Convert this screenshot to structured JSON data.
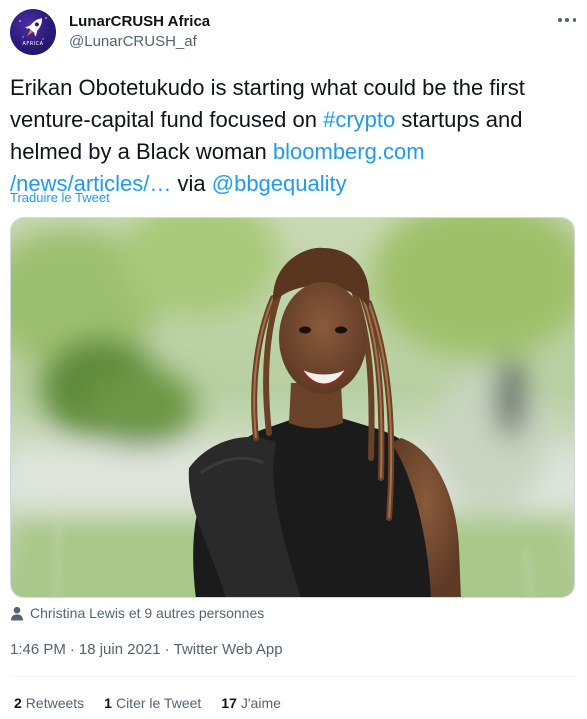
{
  "header": {
    "display_name": "LunarCRUSH Africa",
    "handle": "@LunarCRUSH_af",
    "avatar_text": "AFRICA"
  },
  "tweet": {
    "text_part1": "Erikan Obotetukudo is starting what could be the first venture-capital fund focused on ",
    "hashtag": "#crypto",
    "text_part2": " startups and helmed by a Black woman ",
    "link_line1": "bloomberg.com",
    "link_line2": "/news/articles/…",
    "text_part3": " via ",
    "mention": "@bbgequality",
    "translate_label": "Traduire le Tweet"
  },
  "tagged": {
    "text": "Christina Lewis et 9 autres personnes"
  },
  "meta": {
    "time": "1:46 PM",
    "sep1": "·",
    "date": "18 juin 2021",
    "sep2": "·",
    "source": "Twitter Web App"
  },
  "stats": {
    "retweets_count": "2",
    "retweets_label": "Retweets",
    "quotes_count": "1",
    "quotes_label": "Citer le Tweet",
    "likes_count": "17",
    "likes_label": "J'aime"
  },
  "colors": {
    "link": "#1d9bf0",
    "text": "#0f1419",
    "secondary": "#536471",
    "avatar_bg": "#2b1a78"
  },
  "icons": {
    "more": "more-horizontal-icon",
    "tagged": "person-icon",
    "avatar": "rocket-icon"
  }
}
